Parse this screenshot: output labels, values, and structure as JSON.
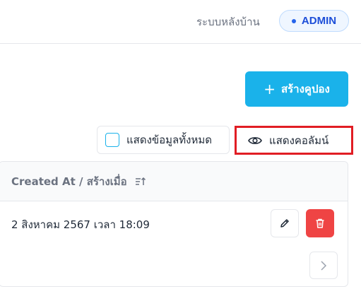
{
  "header": {
    "backend_label": "ระบบหลังบ้าน",
    "role_badge": "ADMIN"
  },
  "actions": {
    "create_coupon_label": "สร้างคูปอง",
    "show_all_label": "แสดงข้อมูลทั้งหมด",
    "show_columns_label": "แสดงคอลัมน์"
  },
  "table": {
    "columns": [
      "Created At / สร้างเมื่อ"
    ],
    "rows": [
      {
        "created_at": "2 สิงหาคม 2567 เวลา 18:09"
      }
    ]
  },
  "icons": {
    "plus": "plus-icon",
    "eye": "eye-icon",
    "sort": "sort-ascending-icon",
    "edit": "pencil-icon",
    "delete": "trash-icon",
    "next": "chevron-right-icon"
  },
  "colors": {
    "primary": "#1ab2ea",
    "danger": "#ef4444",
    "highlight": "#e11d24",
    "badge_text": "#1d4ed8"
  }
}
